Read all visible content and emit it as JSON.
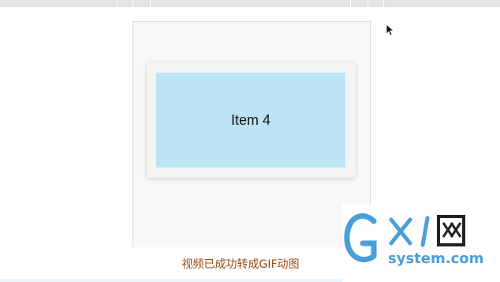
{
  "main": {
    "item_label": "Item 4"
  },
  "footer": {
    "caption": "视频已成功转成GIF动图"
  },
  "watermark": {
    "logo_text": "GXI网",
    "domain": "system.com",
    "color": "#4a9fd8"
  },
  "colors": {
    "item_bg": "#bbe4f5",
    "caption": "#9a4a10"
  }
}
